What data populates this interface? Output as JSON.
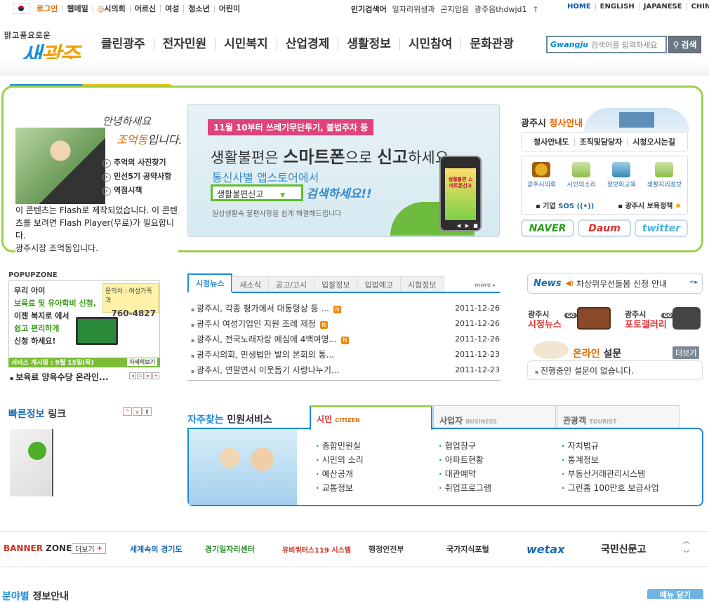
{
  "util": {
    "login": "로그인",
    "webmail": "웹메일",
    "council": "시의회",
    "elderly": "어르신",
    "women": "여성",
    "youth": "청소년",
    "kids": "어린이"
  },
  "popular": {
    "label": "인기검색어",
    "items": [
      "일자리위생과",
      "곤지암읍",
      "광주읍thdwjd1"
    ]
  },
  "lang": [
    "HOME",
    "ENGLISH",
    "JAPANESE",
    "CHINESE"
  ],
  "logo": {
    "tagline": "맑고풍요로운",
    "name_a": "새",
    "name_b": "광주"
  },
  "gnb": [
    "클린광주",
    "전자민원",
    "시민복지",
    "산업경제",
    "생활정보",
    "시민참여",
    "문화관광"
  ],
  "search": {
    "brand": "Gwangju",
    "placeholder": "검색어를 입력하세요",
    "button": "검색"
  },
  "mayor": {
    "greet1": "안녕하세요",
    "greet2a": "조억동",
    "greet2b": "입니다.",
    "links": [
      "추억의 사진찾기",
      "민선5기 공약사항",
      "역점시책"
    ],
    "flash_msg": "이 콘텐츠는 Flash로 제작되었습니다. 이 콘텐츠를 보려면 Flash Player(무료)가 필요합니다.",
    "flash_sig": "광주시장 조억동입니다."
  },
  "banner": {
    "pill": "11월 10부터 쓰레기무단투기, 불법주차 등",
    "title_a": "생활불편은 ",
    "title_b": "스마트폰",
    "title_c": "으로 ",
    "title_d": "신고",
    "title_e": "하세요.",
    "sub": "통신사별 앱스토어에서",
    "box": "생활불편신고",
    "box_tail": "검색하세요!!",
    "small": "일상생활속 불편사항을 쉽게 해결해드립니다",
    "phone_text": "생활불편 스마트폰신고"
  },
  "hall": {
    "title_a": "광주시 ",
    "title_b": "청사안내",
    "tabs": [
      "청사안내도",
      "조직및담당자",
      "시청오시는길"
    ],
    "icons": [
      "광주시의회",
      "시민의소리",
      "정보화교육",
      "생활지리정보"
    ],
    "sos_a": "기업",
    "sos_b": "SOS",
    "policy": "광주시 보육정책"
  },
  "portals": [
    "NAVER",
    "Daum",
    "twitter"
  ],
  "popupzone": {
    "title": "POPUPZONE",
    "lines": [
      "우리 아이",
      "보육료 및 유아학비 신청,",
      "이젠 복지로 에서",
      "쉽고 편리하게",
      "신청 하세요!"
    ],
    "contact_label": "문의처 : 여성가족과",
    "contact_num": "760-4827",
    "bar": "서비스 개시일 : 9월 15일(목)",
    "bar_btn": "자세히보기",
    "caption": "보육료 양육수당 온라인..."
  },
  "news": {
    "tabs": [
      "시정뉴스",
      "새소식",
      "공고/고시",
      "입찰정보",
      "입법예고",
      "시험정보"
    ],
    "more": "more",
    "items": [
      {
        "title": "광주시, 각종 평가에서 대통령상 등 ...",
        "new": "N",
        "date": "2011-12-26"
      },
      {
        "title": "광주시 여성기업인 지원 조례 제정",
        "new": "N",
        "date": "2011-12-26"
      },
      {
        "title": "광주시, 전국노래자랑 예심에 4백여명...",
        "new": "N",
        "date": "2011-12-26"
      },
      {
        "title": "광주시의회, 민생법안 발의 본회의 통...",
        "new": "",
        "date": "2011-12-23"
      },
      {
        "title": "광주시, 연말연시 이웃돕기 사랑나누기...",
        "new": "",
        "date": "2011-12-23"
      }
    ]
  },
  "newsbar": {
    "label": "News",
    "text": "차상위우선돌봄 신청 안내"
  },
  "media": {
    "city_a": "광주시",
    "city_b": "시정뉴스",
    "go": "GO",
    "photo_a": "광주시",
    "photo_b": "포토갤러리"
  },
  "poll": {
    "title_a": "온라인",
    "title_b": " 설문",
    "more": "더보기",
    "text": "진행중인 설문이 없습니다."
  },
  "quick": {
    "title_a": "빠른정보",
    "title_b": " 링크"
  },
  "civic": {
    "title_a": "자주찾는",
    "title_b": " 민원서비스",
    "tabs": [
      {
        "ko": "시민",
        "en": "CITIZEN"
      },
      {
        "ko": "사업자",
        "en": "BUSINESS"
      },
      {
        "ko": "관광객",
        "en": "TOURIST"
      }
    ],
    "col1": [
      "종합민원실",
      "시민의 소리",
      "예산공개",
      "교통정보"
    ],
    "col2": [
      "협업창구",
      "아파트현황",
      "대관예약",
      "취업프로그램"
    ],
    "col3": [
      "자치법규",
      "통계정보",
      "부동산거래관리시스템",
      "그린홈 100만호 보급사업"
    ]
  },
  "bannerzone": {
    "title_a": "BANNER",
    "title_b": " ZONE",
    "more": "더보기",
    "items": [
      "세계속의 경기도",
      "경기일자리센터",
      "유비쿼터스119 시스템",
      "행정안전부",
      "국가지식포털",
      "wetax",
      "국민신문고"
    ]
  },
  "bottom": {
    "title_a": "분야별",
    "title_b": " 정보안내",
    "menu": "메뉴 닫기"
  }
}
